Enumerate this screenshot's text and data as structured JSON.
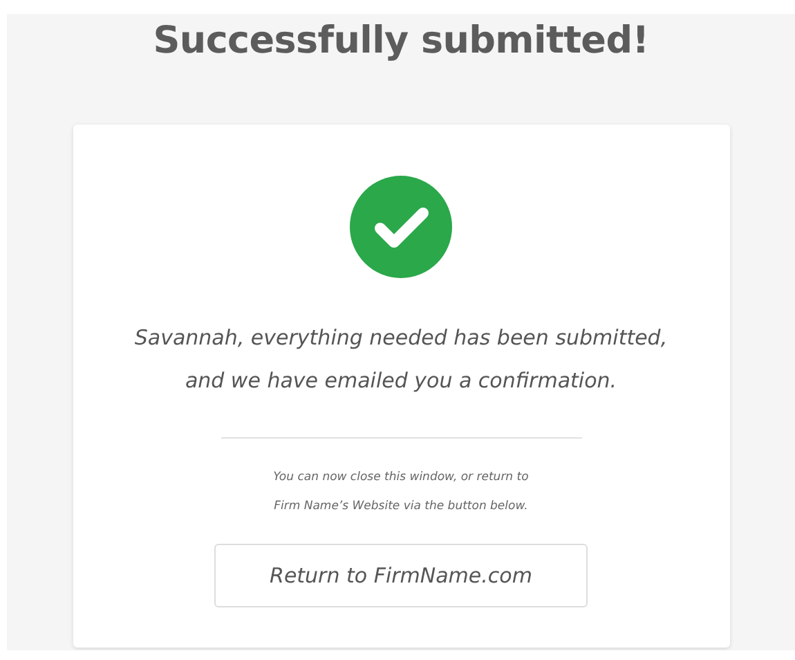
{
  "title": "Successfully submitted!",
  "card": {
    "success": true,
    "message_lines": [
      "Savannah, everything needed has been submitted,",
      "and we have emailed you a confirmation."
    ],
    "note_lines": [
      "You can now close this window, or return to",
      "Firm Name’s Website via the button below."
    ],
    "button": "Return to FirmName.com"
  }
}
